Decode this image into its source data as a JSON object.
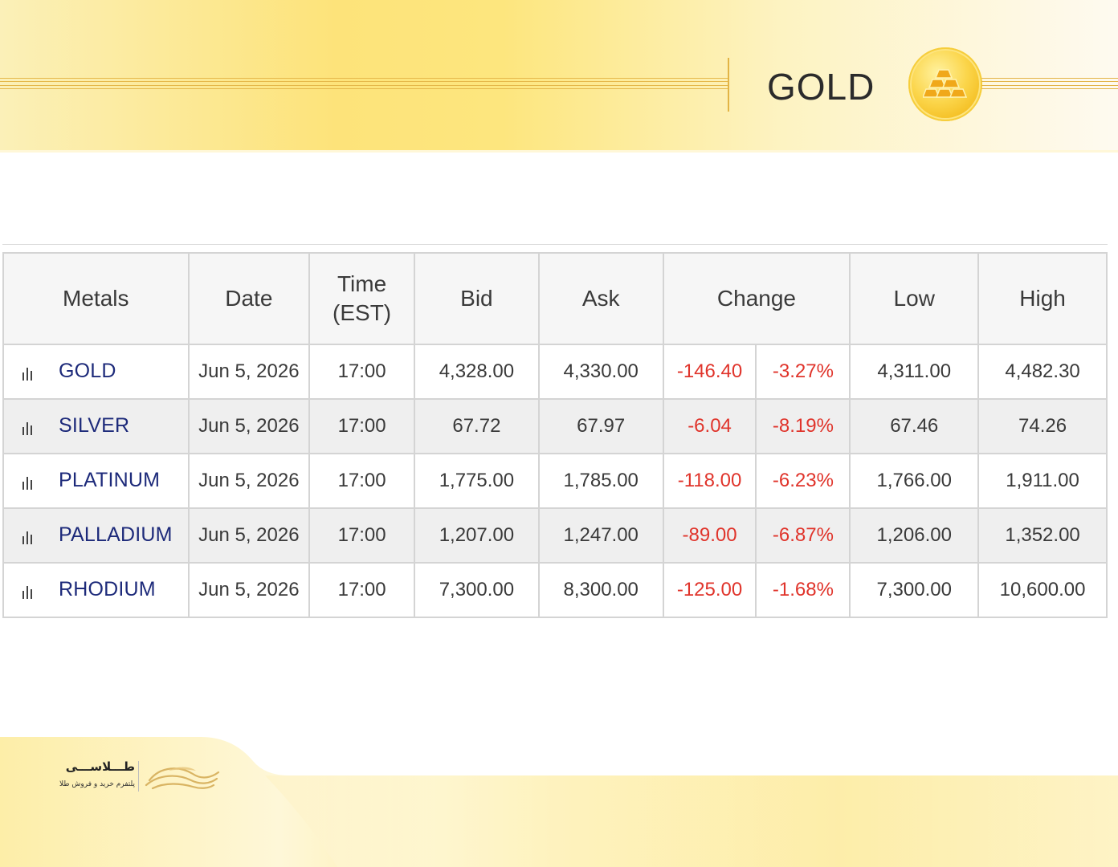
{
  "header": {
    "title": "GOLD",
    "coin_icon": "gold-bars-icon"
  },
  "table": {
    "columns": [
      "Metals",
      "Date",
      "Time\n(EST)",
      "Bid",
      "Ask",
      "Change",
      "Low",
      "High"
    ],
    "rows": [
      {
        "metal": "GOLD",
        "date": "Jun 5, 2026",
        "time": "17:00",
        "bid": "4,328.00",
        "ask": "4,330.00",
        "change": "-146.40",
        "change_pct": "-3.27%",
        "low": "4,311.00",
        "high": "4,482.30"
      },
      {
        "metal": "SILVER",
        "date": "Jun 5, 2026",
        "time": "17:00",
        "bid": "67.72",
        "ask": "67.97",
        "change": "-6.04",
        "change_pct": "-8.19%",
        "low": "67.46",
        "high": "74.26"
      },
      {
        "metal": "PLATINUM",
        "date": "Jun 5, 2026",
        "time": "17:00",
        "bid": "1,775.00",
        "ask": "1,785.00",
        "change": "-118.00",
        "change_pct": "-6.23%",
        "low": "1,766.00",
        "high": "1,911.00"
      },
      {
        "metal": "PALLADIUM",
        "date": "Jun 5, 2026",
        "time": "17:00",
        "bid": "1,207.00",
        "ask": "1,247.00",
        "change": "-89.00",
        "change_pct": "-6.87%",
        "low": "1,206.00",
        "high": "1,352.00"
      },
      {
        "metal": "RHODIUM",
        "date": "Jun 5, 2026",
        "time": "17:00",
        "bid": "7,300.00",
        "ask": "8,300.00",
        "change": "-125.00",
        "change_pct": "-1.68%",
        "low": "7,300.00",
        "high": "10,600.00"
      }
    ],
    "row_icon": "bar-chart-icon",
    "colors": {
      "metal_name": "#1d2a7a",
      "negative": "#e0342b",
      "border": "#d4d4d4",
      "alt_row": "#efefef"
    }
  },
  "footer": {
    "brand_name": "طـــلاســـی",
    "brand_tagline": "پلتفرم خرید و فروش طلا",
    "logo_icon": "gold-wave-logo"
  },
  "theme": {
    "accent": "#fde37a",
    "gold_line": "#e5b84a"
  }
}
